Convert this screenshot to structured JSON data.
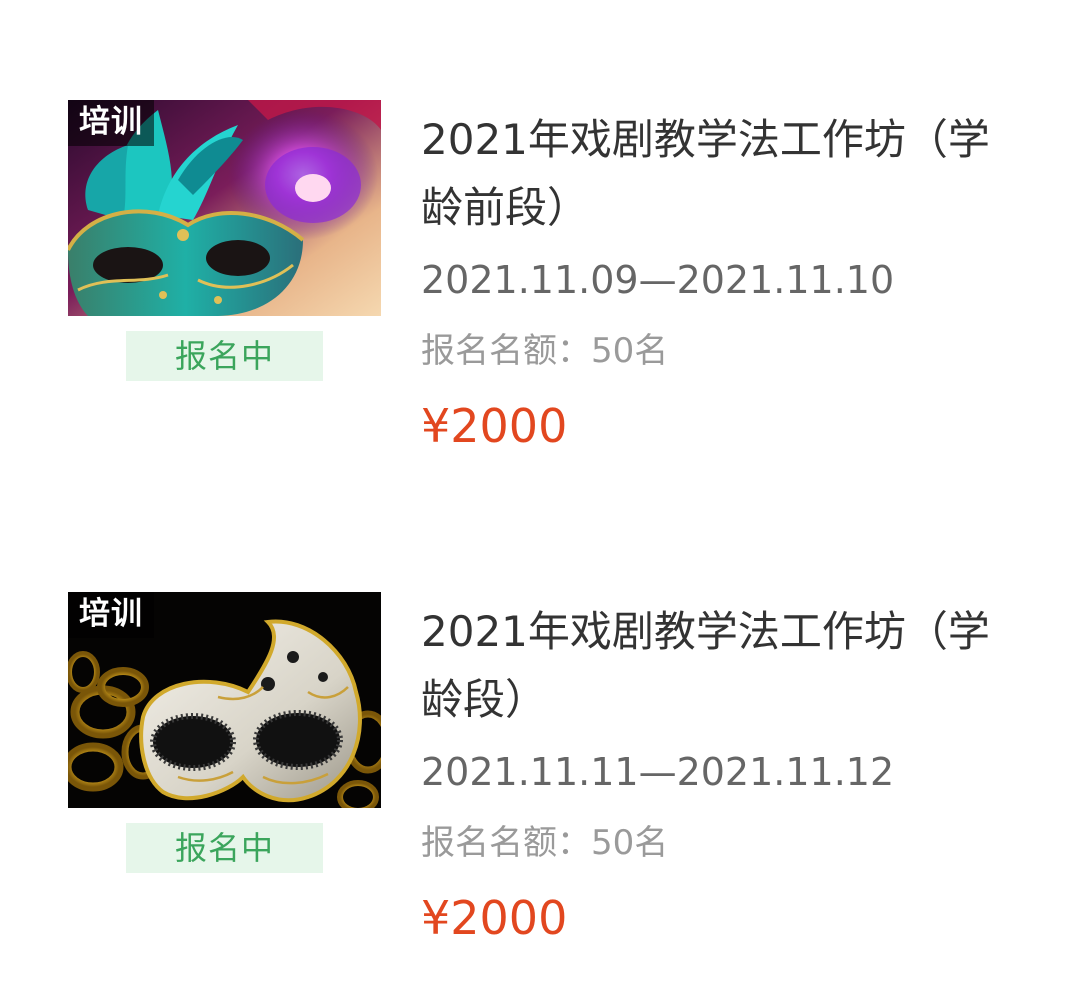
{
  "events": [
    {
      "category": "培训",
      "status": "报名中",
      "title": "2021年戏剧教学法工作坊（学龄前段）",
      "dates": "2021.11.09—2021.11.10",
      "quota": "报名名额：50名",
      "price": "¥2000",
      "image_icon": "colorful-carnival-mask-image"
    },
    {
      "category": "培训",
      "status": "报名中",
      "title": "2021年戏剧教学法工作坊（学龄段）",
      "dates": "2021.11.11—2021.11.12",
      "quota": "报名名额：50名",
      "price": "¥2000",
      "image_icon": "white-gold-mask-image"
    }
  ],
  "colors": {
    "status_bg": "#e6f6ea",
    "status_text": "#3ba55c",
    "price": "#e2471f",
    "title": "#333333",
    "dates": "#666666",
    "quota": "#9a9a9a"
  }
}
